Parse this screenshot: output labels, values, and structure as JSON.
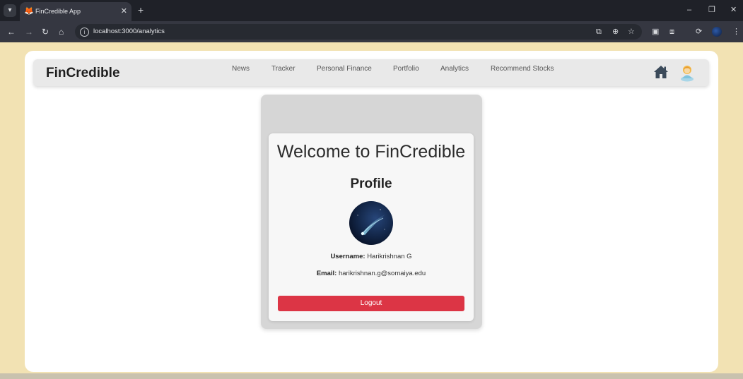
{
  "browser": {
    "tab_title": "FinCredible App",
    "tab_close": "✕",
    "new_tab": "+",
    "url": "localhost:3000/analytics",
    "window_controls": {
      "minimize": "–",
      "restore": "❐",
      "close": "✕"
    }
  },
  "navbar": {
    "brand": "FinCredible",
    "links": [
      "News",
      "Tracker",
      "Personal Finance",
      "Portfolio",
      "Analytics",
      "Recommend Stocks"
    ],
    "icons": [
      "home-icon",
      "avatar-icon"
    ]
  },
  "profile": {
    "welcome": "Welcome to FinCredible",
    "heading": "Profile",
    "username_label": "Username:",
    "username": "Harikrishnan G",
    "email_label": "Email:",
    "email": "harikrishnan.g@somaiya.edu",
    "logout_label": "Logout"
  },
  "colors": {
    "page_background": "#f2e2b3",
    "logout_button": "#dc3545",
    "navbar": "#e9e9e9"
  }
}
